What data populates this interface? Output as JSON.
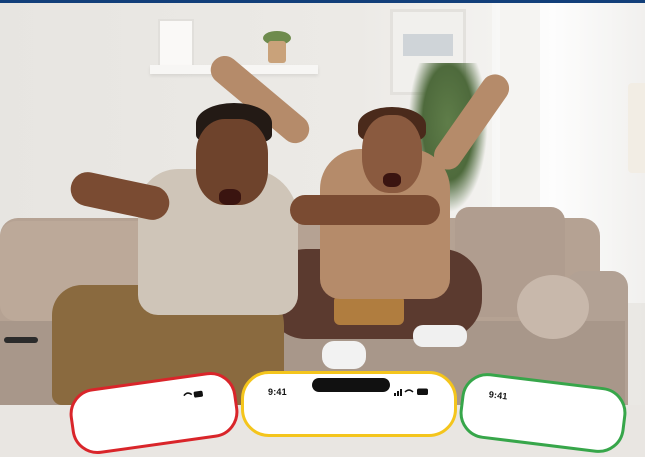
{
  "phones": {
    "center": {
      "time": "9:41",
      "status_icons": "signal-wifi-battery"
    },
    "right": {
      "time": "9:41"
    },
    "left": {
      "status_icons": "wifi-battery"
    }
  },
  "colors": {
    "top_bar": "#123f7a",
    "phone_left_border": "#d9252a",
    "phone_center_border": "#f4c51c",
    "phone_right_border": "#37a64a"
  }
}
